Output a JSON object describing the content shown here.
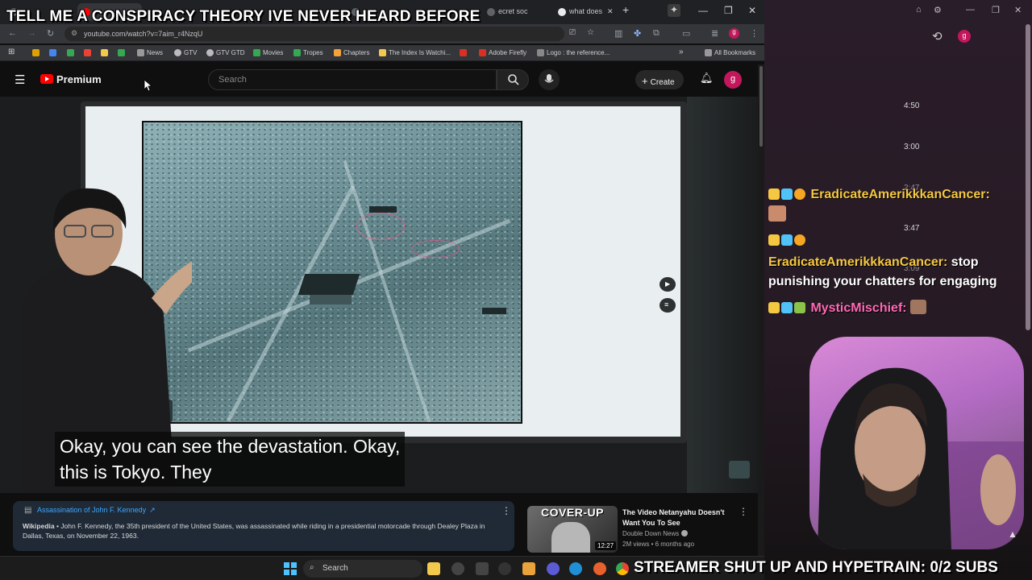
{
  "stream_overlay": {
    "top_text": "TELL ME A CONSPIRACY THEORY IVE NEVER HEARD BEFORE",
    "bottom_text": "STREAMER SHUT UP AND HYPETRAIN: 0/2 SUBS"
  },
  "browser": {
    "tabs": [
      {
        "label": ""
      },
      {
        "label": ""
      },
      {
        "label": ""
      },
      {
        "label": "ecret soc"
      },
      {
        "label": "what does"
      }
    ],
    "url": "youtube.com/watch?v=7aim_r4NzqU",
    "bookmarks": [
      {
        "label": "News",
        "color": "#f2c94c"
      },
      {
        "label": "GTV",
        "color": "#bbbbbb"
      },
      {
        "label": "GTV GTD",
        "color": "#bbbbbb"
      },
      {
        "label": "Movies",
        "color": "#34a853"
      },
      {
        "label": "Tropes",
        "color": "#34a853"
      },
      {
        "label": "Chapters",
        "color": "#f2a33c"
      },
      {
        "label": "The Index Is Watchi...",
        "color": "#f2c94c"
      },
      {
        "label": "",
        "color": "#d93025"
      },
      {
        "label": "Adobe Firefly",
        "color": "#d93025"
      },
      {
        "label": "Logo : the reference...",
        "color": "#888888"
      }
    ],
    "all_bookmarks": "All Bookmarks"
  },
  "youtube": {
    "logo_text": "Premium",
    "search_placeholder": "Search",
    "create_label": "Create",
    "avatar_letter": "g",
    "caption_line1": "Okay, you can see the devastation. Okay,",
    "caption_line2": "this is Tokyo. They",
    "info_card": {
      "title": "Assassination of John F. Kennedy",
      "source": "Wikipedia",
      "text": " • John F. Kennedy, the 35th president of the United States, was assassinated while riding in a presidential motorcade through Dealey Plaza in Dallas, Texas, on November 22, 1963."
    },
    "recommended": {
      "thumb_text": "COVER-UP",
      "duration": "12:27",
      "title": "The Video Netanyahu Doesn't Want You To See",
      "channel": "Double Down News",
      "meta": "2M views • 6 months ago"
    }
  },
  "chat": {
    "timestamps": [
      "4:50",
      "3:00",
      "2:47",
      "3:47",
      "3:09"
    ],
    "messages": [
      {
        "user": "EradicateAmerikkkanCancer:",
        "text": ""
      },
      {
        "user": "EradicateAmerikkkanCancer:",
        "text": "stop punishing your chatters for engaging"
      },
      {
        "user": "MysticMischief:",
        "text": ""
      }
    ],
    "avatar_letter": "g"
  },
  "taskbar": {
    "search_placeholder": "Search"
  },
  "colors": {
    "accent_red": "#ff0000",
    "link_blue": "#3ea6ff",
    "chat_gold": "#f5c842"
  }
}
